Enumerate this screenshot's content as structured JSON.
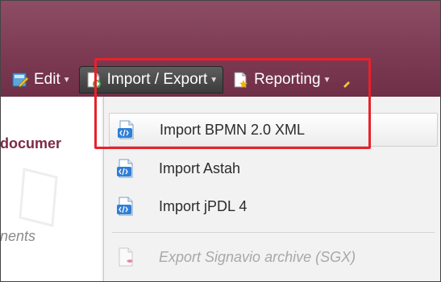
{
  "toolbar": {
    "edit": {
      "label": "Edit",
      "icon": "edit-icon"
    },
    "import_export": {
      "label": "Import / Export",
      "icon": "import-export-icon"
    },
    "reporting": {
      "label": "Reporting",
      "icon": "reporting-icon"
    }
  },
  "left": {
    "doc_label": "documer",
    "ments": "nents"
  },
  "menu": {
    "items": [
      {
        "label": "Import BPMN 2.0 XML",
        "icon": "import-file-icon",
        "state": "hover"
      },
      {
        "label": "Import Astah",
        "icon": "import-file-icon"
      },
      {
        "label": "Import jPDL 4",
        "icon": "import-file-icon"
      },
      {
        "label": "Export Signavio archive (SGX)",
        "icon": "export-file-icon",
        "state": "disabled"
      }
    ]
  },
  "colors": {
    "header": "#7b3a52",
    "highlight": "#e8212b",
    "active_toolbar": "#3b3b3b"
  }
}
